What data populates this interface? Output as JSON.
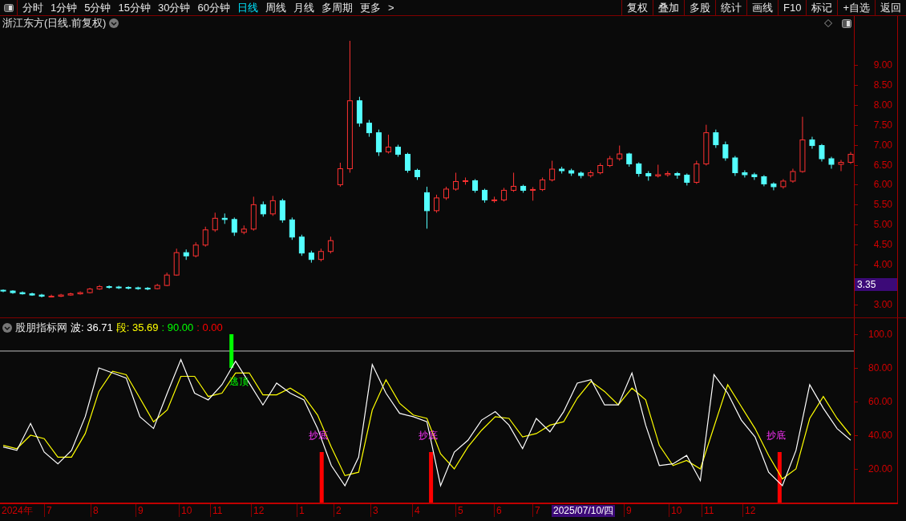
{
  "toolbar": {
    "periods": [
      {
        "label": "分时",
        "selected": false
      },
      {
        "label": "1分钟",
        "selected": false
      },
      {
        "label": "5分钟",
        "selected": false
      },
      {
        "label": "15分钟",
        "selected": false
      },
      {
        "label": "30分钟",
        "selected": false
      },
      {
        "label": "60分钟",
        "selected": false
      },
      {
        "label": "日线",
        "selected": true
      },
      {
        "label": "周线",
        "selected": false
      },
      {
        "label": "月线",
        "selected": false
      },
      {
        "label": "多周期",
        "selected": false
      },
      {
        "label": "更多",
        "selected": false
      }
    ],
    "more_arrow": ">",
    "actions": [
      "复权",
      "叠加",
      "多股",
      "统计",
      "画线",
      "F10",
      "标记",
      "+自选",
      "返回"
    ]
  },
  "main_chart": {
    "title": "浙江东方(日线.前复权)",
    "price_tag": "3.35",
    "chart_data": {
      "type": "candlestick",
      "ylim": [
        2.68,
        10.22
      ],
      "yticks": [
        {
          "value": 9,
          "label": "9.00"
        },
        {
          "value": 8.5,
          "label": "8.50"
        },
        {
          "value": 8,
          "label": "8.00"
        },
        {
          "value": 7.5,
          "label": "7.50"
        },
        {
          "value": 7,
          "label": "7.00"
        },
        {
          "value": 6.5,
          "label": "6.50"
        },
        {
          "value": 6,
          "label": "6.00"
        },
        {
          "value": 5.5,
          "label": "5.50"
        },
        {
          "value": 5,
          "label": "5.00"
        },
        {
          "value": 4.5,
          "label": "4.50"
        },
        {
          "value": 4,
          "label": "4.00"
        },
        {
          "value": 3,
          "label": "3.00"
        }
      ],
      "ohlc": [
        [
          3.36,
          3.38,
          3.31,
          3.34
        ],
        [
          3.34,
          3.36,
          3.27,
          3.3
        ],
        [
          3.3,
          3.33,
          3.25,
          3.27
        ],
        [
          3.27,
          3.3,
          3.22,
          3.24
        ],
        [
          3.24,
          3.27,
          3.18,
          3.21
        ],
        [
          3.21,
          3.25,
          3.18,
          3.21
        ],
        [
          3.21,
          3.27,
          3.19,
          3.24
        ],
        [
          3.24,
          3.3,
          3.22,
          3.27
        ],
        [
          3.27,
          3.33,
          3.25,
          3.3
        ],
        [
          3.3,
          3.42,
          3.28,
          3.39
        ],
        [
          3.39,
          3.49,
          3.37,
          3.45
        ],
        [
          3.45,
          3.48,
          3.4,
          3.44
        ],
        [
          3.44,
          3.47,
          3.39,
          3.43
        ],
        [
          3.43,
          3.46,
          3.38,
          3.42
        ],
        [
          3.42,
          3.45,
          3.37,
          3.41
        ],
        [
          3.41,
          3.44,
          3.36,
          3.4
        ],
        [
          3.4,
          3.52,
          3.38,
          3.48
        ],
        [
          3.48,
          3.8,
          3.46,
          3.74
        ],
        [
          3.74,
          4.4,
          3.72,
          4.3
        ],
        [
          4.3,
          4.38,
          4.12,
          4.22
        ],
        [
          4.22,
          4.56,
          4.18,
          4.49
        ],
        [
          4.49,
          4.95,
          4.45,
          4.87
        ],
        [
          4.87,
          5.3,
          4.82,
          5.16
        ],
        [
          5.16,
          5.28,
          5.02,
          5.13
        ],
        [
          5.13,
          5.18,
          4.72,
          4.81
        ],
        [
          4.81,
          4.98,
          4.76,
          4.89
        ],
        [
          4.89,
          5.7,
          4.85,
          5.5
        ],
        [
          5.5,
          5.58,
          5.2,
          5.27
        ],
        [
          5.27,
          5.72,
          5.22,
          5.6
        ],
        [
          5.6,
          5.65,
          5.05,
          5.12
        ],
        [
          5.12,
          5.18,
          4.62,
          4.69
        ],
        [
          4.69,
          4.75,
          4.22,
          4.29
        ],
        [
          4.29,
          4.35,
          4.05,
          4.13
        ],
        [
          4.13,
          4.4,
          4.08,
          4.33
        ],
        [
          4.33,
          4.7,
          4.28,
          4.6
        ],
        [
          6.0,
          6.55,
          5.95,
          6.4
        ],
        [
          6.4,
          9.6,
          6.3,
          8.1
        ],
        [
          8.1,
          8.2,
          7.45,
          7.54
        ],
        [
          7.54,
          7.62,
          7.2,
          7.3
        ],
        [
          7.3,
          7.38,
          6.72,
          6.82
        ],
        [
          6.82,
          7.25,
          6.78,
          6.94
        ],
        [
          6.94,
          7.0,
          6.7,
          6.76
        ],
        [
          6.76,
          6.8,
          6.3,
          6.36
        ],
        [
          6.36,
          6.4,
          6.12,
          6.2
        ],
        [
          5.8,
          5.95,
          4.9,
          5.35
        ],
        [
          5.35,
          5.75,
          5.3,
          5.67
        ],
        [
          5.67,
          5.95,
          5.62,
          5.89
        ],
        [
          5.89,
          6.3,
          5.85,
          6.08
        ],
        [
          6.08,
          6.18,
          6.0,
          6.1
        ],
        [
          6.1,
          6.14,
          5.8,
          5.86
        ],
        [
          5.86,
          5.9,
          5.55,
          5.62
        ],
        [
          5.62,
          5.7,
          5.55,
          5.62
        ],
        [
          5.62,
          5.92,
          5.58,
          5.86
        ],
        [
          5.86,
          6.3,
          5.82,
          5.96
        ],
        [
          5.96,
          6.0,
          5.8,
          5.86
        ],
        [
          5.86,
          5.94,
          5.6,
          5.88
        ],
        [
          5.88,
          6.18,
          5.84,
          6.12
        ],
        [
          6.12,
          6.6,
          6.08,
          6.39
        ],
        [
          6.39,
          6.45,
          6.28,
          6.35
        ],
        [
          6.35,
          6.4,
          6.22,
          6.29
        ],
        [
          6.29,
          6.33,
          6.16,
          6.23
        ],
        [
          6.23,
          6.36,
          6.18,
          6.3
        ],
        [
          6.3,
          6.54,
          6.26,
          6.48
        ],
        [
          6.48,
          6.72,
          6.44,
          6.65
        ],
        [
          6.65,
          6.98,
          6.6,
          6.77
        ],
        [
          6.77,
          6.8,
          6.45,
          6.52
        ],
        [
          6.52,
          6.56,
          6.2,
          6.28
        ],
        [
          6.28,
          6.34,
          6.1,
          6.22
        ],
        [
          6.22,
          6.5,
          6.18,
          6.25
        ],
        [
          6.25,
          6.34,
          6.2,
          6.28
        ],
        [
          6.28,
          6.32,
          6.15,
          6.24
        ],
        [
          6.24,
          6.28,
          5.98,
          6.06
        ],
        [
          6.06,
          6.6,
          6.02,
          6.52
        ],
        [
          6.52,
          7.5,
          6.48,
          7.3
        ],
        [
          7.3,
          7.38,
          6.92,
          7.0
        ],
        [
          7.0,
          7.08,
          6.6,
          6.67
        ],
        [
          6.67,
          6.72,
          6.22,
          6.3
        ],
        [
          6.3,
          6.36,
          6.18,
          6.25
        ],
        [
          6.25,
          6.3,
          6.12,
          6.2
        ],
        [
          6.2,
          6.24,
          5.96,
          6.02
        ],
        [
          6.02,
          6.06,
          5.86,
          5.95
        ],
        [
          5.95,
          6.14,
          5.9,
          6.09
        ],
        [
          6.09,
          6.4,
          6.05,
          6.33
        ],
        [
          6.33,
          7.7,
          6.3,
          7.12
        ],
        [
          7.12,
          7.2,
          6.9,
          6.98
        ],
        [
          6.98,
          7.02,
          6.58,
          6.65
        ],
        [
          6.65,
          6.7,
          6.4,
          6.51
        ],
        [
          6.51,
          6.62,
          6.34,
          6.56
        ],
        [
          6.56,
          6.82,
          6.52,
          6.76
        ]
      ]
    }
  },
  "indicator": {
    "name": "股朋指标网",
    "legend": [
      {
        "text": "波: 36.71",
        "color": "#ffffff"
      },
      {
        "text": "段: 35.69",
        "color": "#ffff00"
      },
      {
        "text": ": 90.00",
        "color": "#00ff00"
      },
      {
        "text": ": 0.00",
        "color": "#ff0000"
      }
    ],
    "signals": [
      {
        "kind": "top",
        "label": "逃顶"
      },
      {
        "kind": "bottom",
        "label": "抄底"
      },
      {
        "kind": "bottom",
        "label": "抄底"
      },
      {
        "kind": "bottom",
        "label": "抄底"
      }
    ],
    "chart_data": {
      "type": "line",
      "ylim": [
        0,
        109.5
      ],
      "yticks": [
        {
          "value": 20,
          "label": "20.00"
        },
        {
          "value": 40,
          "label": "40.00"
        },
        {
          "value": 60,
          "label": "60.00"
        },
        {
          "value": 80,
          "label": "80.00"
        },
        {
          "value": 100,
          "label": "100.0"
        }
      ],
      "series": [
        {
          "color": "#ffffff",
          "values": [
            33,
            31,
            47,
            30,
            23,
            31,
            51,
            80,
            77,
            74,
            51,
            44,
            65,
            85,
            65,
            61,
            70,
            84,
            71,
            58,
            71,
            65,
            61,
            44,
            22,
            10,
            27,
            82,
            65,
            53,
            51,
            48,
            10,
            30,
            37,
            49,
            54,
            46,
            32,
            50,
            42,
            54,
            71,
            73,
            58,
            58,
            77,
            46,
            22,
            23,
            28,
            13,
            76,
            65,
            49,
            39,
            18,
            10,
            31,
            70,
            56,
            44,
            37
          ]
        },
        {
          "color": "#ffff00",
          "values": [
            34,
            32,
            40,
            38,
            27,
            27,
            41,
            66,
            78,
            76,
            62,
            48,
            55,
            75,
            75,
            63,
            65,
            77,
            77,
            64,
            64,
            68,
            63,
            52,
            33,
            16,
            18,
            55,
            73,
            59,
            52,
            50,
            29,
            20,
            33,
            43,
            51,
            50,
            39,
            41,
            46,
            48,
            62,
            72,
            66,
            58,
            68,
            61,
            34,
            22,
            25,
            20,
            45,
            70,
            57,
            44,
            28,
            14,
            20,
            50,
            63,
            50,
            40
          ]
        }
      ]
    }
  },
  "date_axis": [
    {
      "label": "2024年",
      "selected": false
    },
    {
      "label": "7",
      "selected": false
    },
    {
      "label": "8",
      "selected": false
    },
    {
      "label": "9",
      "selected": false
    },
    {
      "label": "10",
      "selected": false
    },
    {
      "label": "11",
      "selected": false
    },
    {
      "label": "12",
      "selected": false
    },
    {
      "label": "1",
      "selected": false
    },
    {
      "label": "2",
      "selected": false
    },
    {
      "label": "3",
      "selected": false
    },
    {
      "label": "4",
      "selected": false
    },
    {
      "label": "5",
      "selected": false
    },
    {
      "label": "6",
      "selected": false
    },
    {
      "label": "7",
      "selected": false
    },
    {
      "label": "2025/07/10/四",
      "selected": true
    },
    {
      "label": "9",
      "selected": false
    },
    {
      "label": "10",
      "selected": false
    },
    {
      "label": "11",
      "selected": false
    },
    {
      "label": "12",
      "selected": false
    }
  ]
}
